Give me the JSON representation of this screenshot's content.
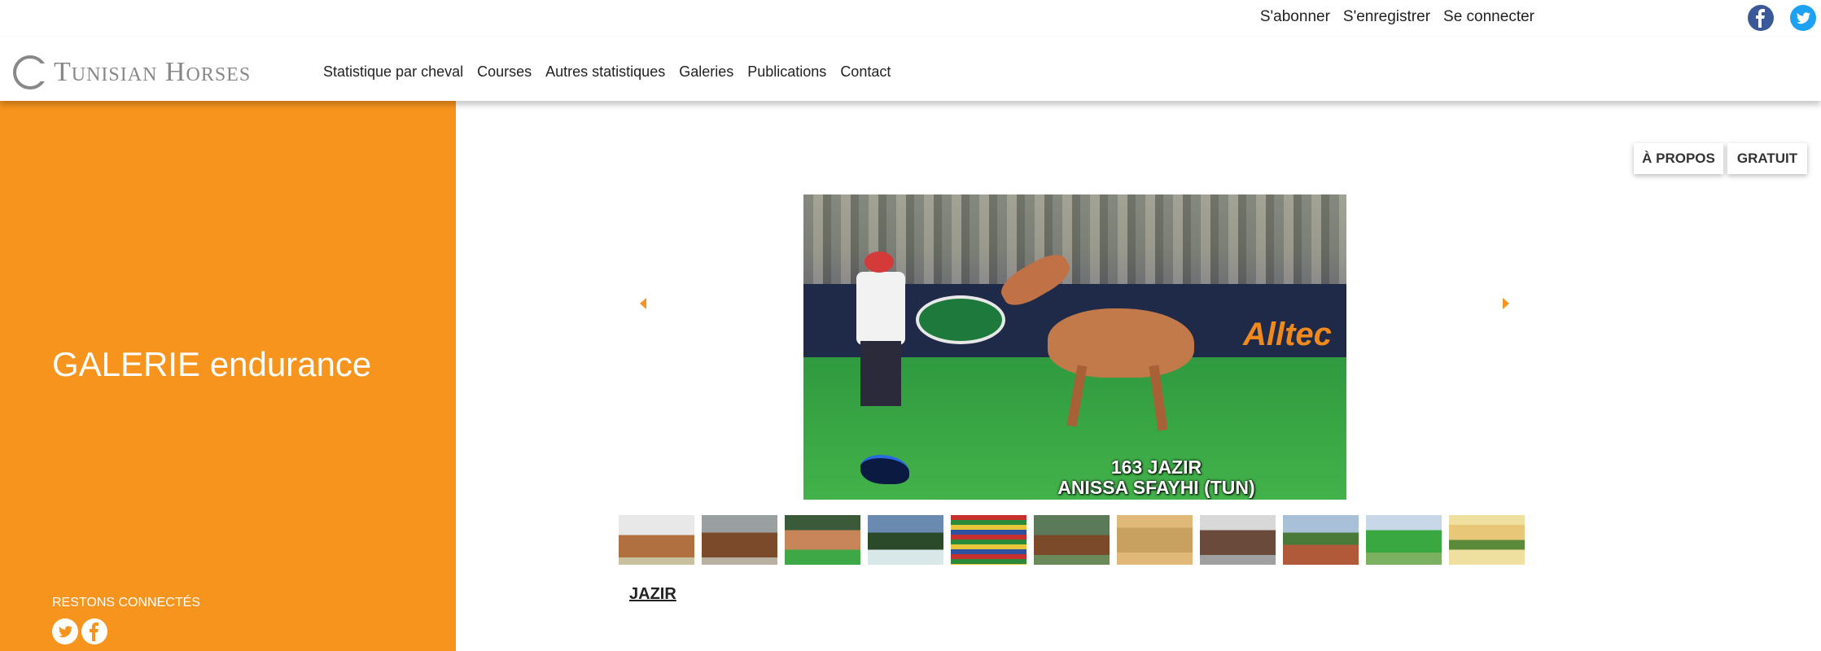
{
  "top_links": {
    "subscribe": "S'abonner",
    "register": "S'enregistrer",
    "login": "Se connecter"
  },
  "social_icons": [
    "facebook-icon",
    "twitter-icon"
  ],
  "logo": {
    "text": "Tunisian Horses"
  },
  "nav": {
    "items": [
      "Statistique par cheval",
      "Courses",
      "Autres statistiques",
      "Galeries",
      "Publications",
      "Contact"
    ]
  },
  "sidebar": {
    "title": "GALERIE endurance",
    "stay_connected": "RESTONS CONNECTÉS",
    "background_color": "#f7941d"
  },
  "buttons": {
    "about": "À PROPOS",
    "free": "GRATUIT"
  },
  "main_image": {
    "caption_line1": "163 JAZIR",
    "caption_line2": "ANISSA SFAYHI (TUN)",
    "banner_text": "Alltec"
  },
  "thumbnails_count": 11,
  "image_title": "JAZIR"
}
